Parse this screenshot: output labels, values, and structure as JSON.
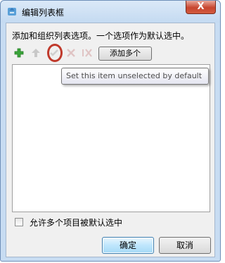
{
  "window": {
    "title": "编辑列表框",
    "close_label": "X"
  },
  "instruction": "添加和组织列表选项。一个选项作为默认选中。",
  "toolbar": {
    "add_multiple_label": "添加多个",
    "icons": [
      "add-icon",
      "move-up-icon",
      "set-unselected-default-icon",
      "delete-icon",
      "clear-default-icon"
    ]
  },
  "tooltip": "Set this item unselected by default",
  "checkbox": {
    "label": "允许多个项目被默认选中",
    "checked": false
  },
  "buttons": {
    "ok_label": "确定",
    "cancel_label": "取消"
  },
  "colors": {
    "highlight_ring": "#c0392b",
    "add_icon": "#3aa53a"
  }
}
